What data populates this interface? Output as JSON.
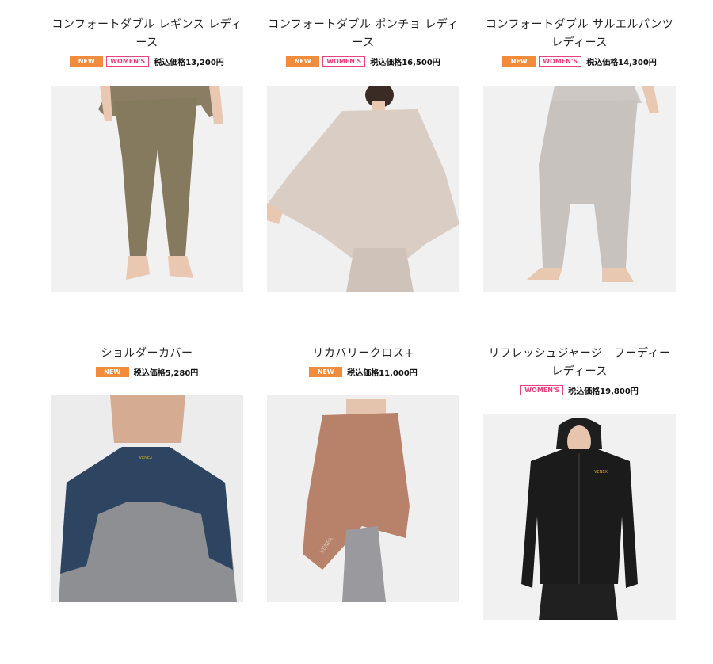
{
  "products": [
    {
      "title": "コンフォートダブル レギンス レディース",
      "new": "NEW",
      "women": "WOMEN'S",
      "price": "税込価格13,200円"
    },
    {
      "title": "コンフォートダブル ポンチョ レディース",
      "new": "NEW",
      "women": "WOMEN'S",
      "price": "税込価格16,500円"
    },
    {
      "title": "コンフォートダブル サルエルパンツ レディース",
      "new": "NEW",
      "women": "WOMEN'S",
      "price": "税込価格14,300円"
    },
    {
      "title": "ショルダーカバー",
      "new": "NEW",
      "price": "税込価格5,280円"
    },
    {
      "title": "リカバリークロス+",
      "new": "NEW",
      "price": "税込価格11,000円"
    },
    {
      "title": "リフレッシュジャージ　フーディー　レディース",
      "women": "WOMEN'S",
      "price": "税込価格19,800円"
    }
  ],
  "colors": {
    "new_badge": "#f28c3a",
    "women_badge": "#e8437f",
    "image_bg": "#f2f2f2"
  }
}
